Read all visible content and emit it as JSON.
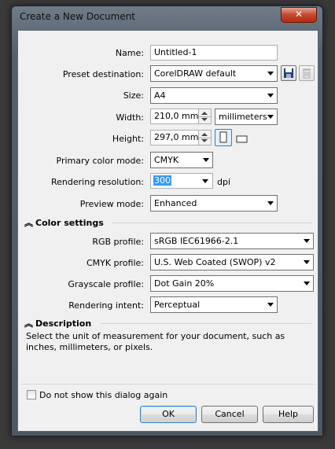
{
  "window": {
    "title": "Create a New Document",
    "close_glyph": "✕"
  },
  "form": {
    "name": {
      "label": "Name:",
      "value": "Untitled-1"
    },
    "preset": {
      "label": "Preset destination:",
      "value": "CorelDRAW default",
      "save_icon": "save-icon",
      "delete_icon": "delete-icon"
    },
    "size": {
      "label": "Size:",
      "value": "A4"
    },
    "width": {
      "label": "Width:",
      "value": "210,0 mm",
      "units": "millimeters"
    },
    "height": {
      "label": "Height:",
      "value": "297,0 mm",
      "portrait_icon": "portrait-icon",
      "landscape_icon": "landscape-icon"
    },
    "color_mode": {
      "label": "Primary color mode:",
      "value": "CMYK"
    },
    "resolution": {
      "label": "Rendering resolution:",
      "value": "300",
      "unit": "dpi"
    },
    "preview": {
      "label": "Preview mode:",
      "value": "Enhanced"
    }
  },
  "color_settings": {
    "heading": "Color settings",
    "rgb": {
      "label": "RGB profile:",
      "value": "sRGB IEC61966-2.1"
    },
    "cmyk": {
      "label": "CMYK profile:",
      "value": "U.S. Web Coated (SWOP) v2"
    },
    "gray": {
      "label": "Grayscale profile:",
      "value": "Dot Gain 20%"
    },
    "intent": {
      "label": "Rendering intent:",
      "value": "Perceptual"
    }
  },
  "description": {
    "heading": "Description",
    "text": "Select the unit of measurement for your document, such as inches, millimeters, or pixels."
  },
  "footer": {
    "dont_show": "Do not show this dialog again",
    "ok": "OK",
    "cancel": "Cancel",
    "help": "Help"
  },
  "colors": {
    "titlebar": "#6f7b88",
    "client": "#f0f0f0",
    "close": "#c8452c",
    "selection": "#3399ff"
  }
}
